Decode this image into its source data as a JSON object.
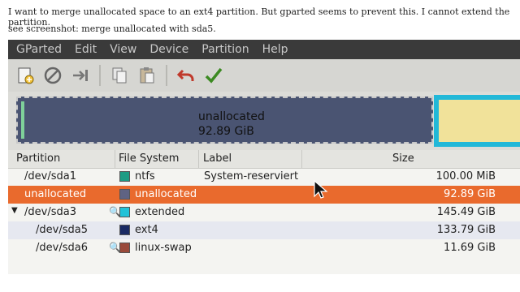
{
  "intro": {
    "line1": "I want to merge unallocated space to an ext4 partition. But gparted seems to prevent this. I cannot extend the partition.",
    "line2": "see screenshot: merge unallocated with sda5."
  },
  "menu": [
    "GParted",
    "Edit",
    "View",
    "Device",
    "Partition",
    "Help"
  ],
  "diskmap": {
    "unallocated_label": "unallocated",
    "unallocated_size": "92.89 GiB"
  },
  "table": {
    "headers": {
      "partition": "Partition",
      "filesystem": "File System",
      "label": "Label",
      "size": "Size"
    },
    "rows": [
      {
        "partition": "/dev/sda1",
        "filesystem": "ntfs",
        "label": "System-reserviert",
        "size": "100.00 MiB",
        "color": "#1d9c84"
      },
      {
        "partition": "unallocated",
        "filesystem": "unallocated",
        "label": "",
        "size": "92.89 GiB",
        "color": "#5f6383"
      },
      {
        "partition": "/dev/sda3",
        "filesystem": "extended",
        "label": "",
        "size": "145.49 GiB",
        "color": "#22c2d8"
      },
      {
        "partition": "/dev/sda5",
        "filesystem": "ext4",
        "label": "",
        "size": "133.79 GiB",
        "color": "#1a2a63"
      },
      {
        "partition": "/dev/sda6",
        "filesystem": "linux-swap",
        "label": "",
        "size": "11.69 GiB",
        "color": "#9a4a3a"
      }
    ]
  },
  "colors": {
    "selected_row": "#e96a2d",
    "unallocated_block": "#4a5472",
    "extended_border": "#22b8d8"
  }
}
